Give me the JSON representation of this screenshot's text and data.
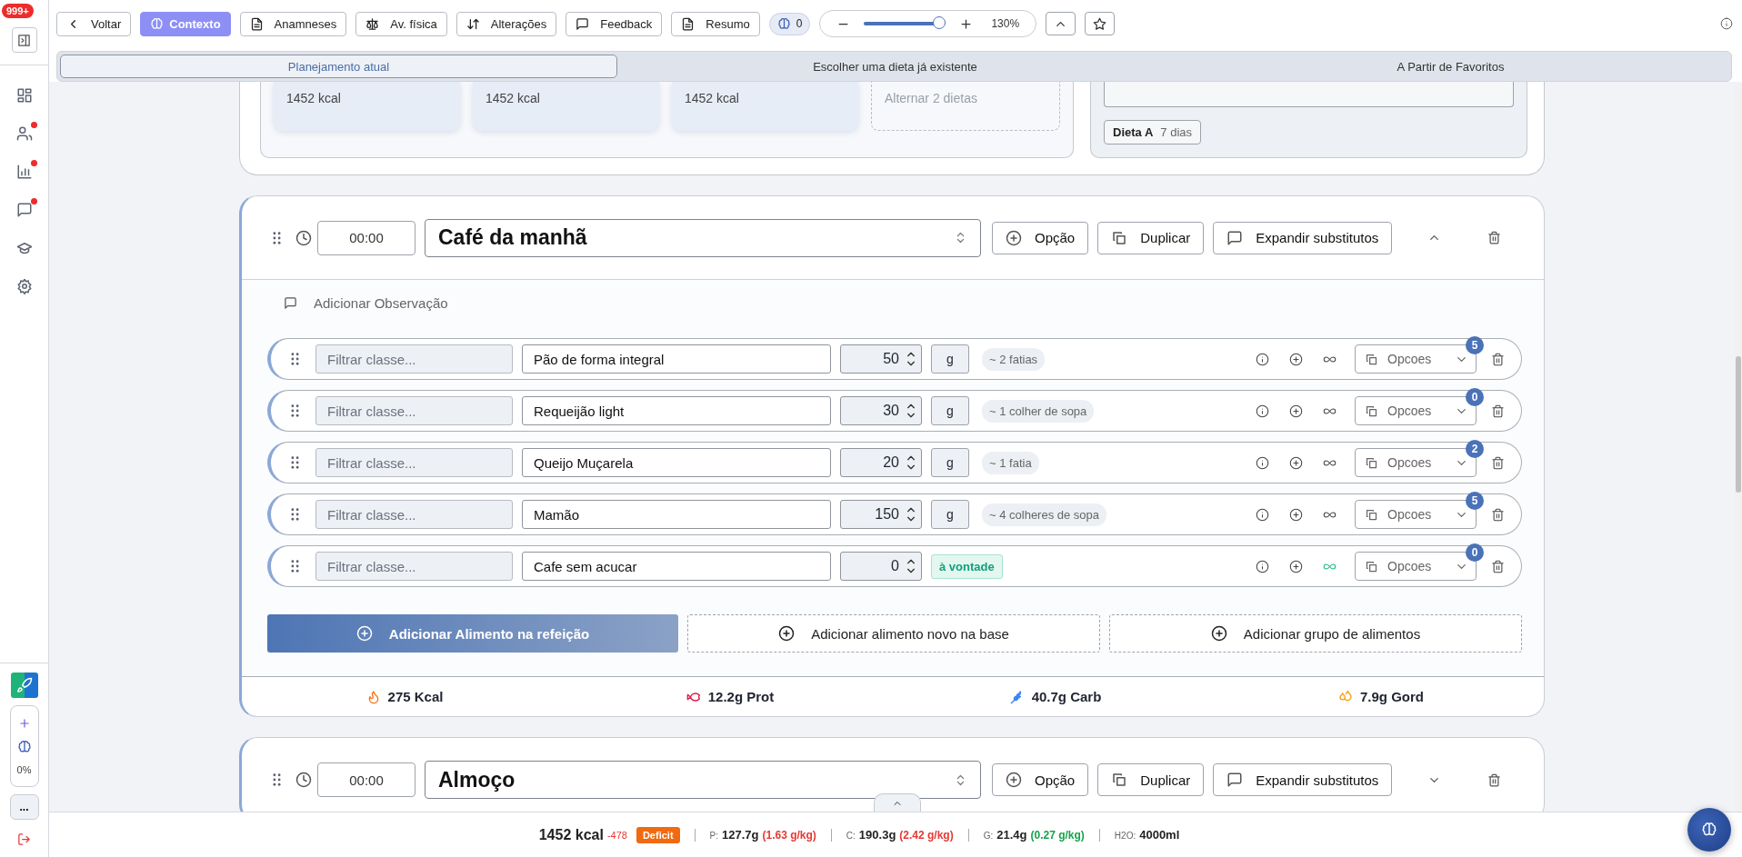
{
  "sidebar": {
    "notification_badge": "999+",
    "nav_items": [
      {
        "kind": "dashboard",
        "alert": false
      },
      {
        "kind": "patients",
        "alert": true
      },
      {
        "kind": "reports",
        "alert": true
      },
      {
        "kind": "messages",
        "alert": true
      },
      {
        "kind": "courses",
        "alert": false
      },
      {
        "kind": "settings",
        "alert": false
      }
    ],
    "ai_widget": {
      "percent": "0%"
    },
    "more_label": "..."
  },
  "toolbar": {
    "buttons": [
      {
        "kind": "back",
        "label": "Voltar",
        "active": false
      },
      {
        "kind": "context",
        "label": "Contexto",
        "active": true
      },
      {
        "kind": "document",
        "label": "Anamneses",
        "active": false
      },
      {
        "kind": "scale",
        "label": "Av. física",
        "active": false
      },
      {
        "kind": "sort",
        "label": "Alterações",
        "active": false
      },
      {
        "kind": "chat",
        "label": "Feedback",
        "active": false
      },
      {
        "kind": "document",
        "label": "Resumo",
        "active": false
      }
    ],
    "ai_counter": "0",
    "zoom": {
      "level": 0.92,
      "reading": "130%"
    }
  },
  "tabs": [
    {
      "label": "Planejamento atual",
      "selected": true
    },
    {
      "label": "Escolher uma dieta já existente",
      "selected": false
    },
    {
      "label": "A Partir de Favoritos",
      "selected": false
    }
  ],
  "top_section": {
    "day_cards": [
      "1452 kcal",
      "1452 kcal",
      "1452 kcal"
    ],
    "alternate_card": "Alternar 2 dietas",
    "diet_tag": {
      "name": "Dieta A",
      "days": "7 dias"
    }
  },
  "meals": [
    {
      "time": "00:00",
      "name": "Café da manhã",
      "expanded": true,
      "actions": [
        {
          "kind": "add",
          "label": "Opção"
        },
        {
          "kind": "copy",
          "label": "Duplicar"
        },
        {
          "kind": "chat",
          "label": "Expandir substitutos"
        }
      ],
      "observation_label": "Adicionar Observação",
      "foods": [
        {
          "class_placeholder": "Filtrar classe...",
          "name": "Pão de forma integral",
          "quantity": "50",
          "unit": "g",
          "portion": "~ 2 fatias",
          "free": false,
          "substitutes": "5",
          "options_label": "Opcoes"
        },
        {
          "class_placeholder": "Filtrar classe...",
          "name": "Requeijão light",
          "quantity": "30",
          "unit": "g",
          "portion": "~ 1 colher de sopa",
          "free": false,
          "substitutes": "0",
          "options_label": "Opcoes"
        },
        {
          "class_placeholder": "Filtrar classe...",
          "name": "Queijo Muçarela",
          "quantity": "20",
          "unit": "g",
          "portion": "~ 1 fatia",
          "free": false,
          "substitutes": "2",
          "options_label": "Opcoes"
        },
        {
          "class_placeholder": "Filtrar classe...",
          "name": "Mamão",
          "quantity": "150",
          "unit": "g",
          "portion": "~ 4 colheres de sopa",
          "free": false,
          "substitutes": "5",
          "options_label": "Opcoes"
        },
        {
          "class_placeholder": "Filtrar classe...",
          "name": "Cafe sem acucar",
          "quantity": "0",
          "portion": "à vontade",
          "free": true,
          "substitutes": "0",
          "options_label": "Opcoes"
        }
      ],
      "add_buttons": [
        {
          "kind": "primary",
          "label": "Adicionar Alimento na refeição"
        },
        {
          "kind": "outline",
          "label": "Adicionar alimento novo na base"
        },
        {
          "kind": "outline",
          "label": "Adicionar grupo de alimentos"
        }
      ],
      "macros": [
        {
          "kind": "energy",
          "text": "275 Kcal"
        },
        {
          "kind": "protein",
          "text": "12.2g Prot"
        },
        {
          "kind": "carbs",
          "text": "40.7g Carb"
        },
        {
          "kind": "fat",
          "text": "7.9g Gord"
        }
      ]
    },
    {
      "time": "00:00",
      "name": "Almoço",
      "expanded": false,
      "actions": [
        {
          "kind": "add",
          "label": "Opção"
        },
        {
          "kind": "copy",
          "label": "Duplicar"
        },
        {
          "kind": "chat",
          "label": "Expandir substitutos"
        }
      ]
    }
  ],
  "summary_bar": {
    "kcal": "1452 kcal",
    "delta": "-478",
    "status": "Deficit",
    "macros": [
      {
        "label": "P:",
        "value": "127.7g",
        "per_kg": "(1.63 g/kg)",
        "color": "#e53935"
      },
      {
        "label": "C:",
        "value": "190.3g",
        "per_kg": "(2.42 g/kg)",
        "color": "#e53935"
      },
      {
        "label": "G:",
        "value": "21.4g",
        "per_kg": "(0.27 g/kg)",
        "color": "#16a34a"
      }
    ],
    "water": {
      "label": "H2O:",
      "value": "4000ml"
    }
  }
}
